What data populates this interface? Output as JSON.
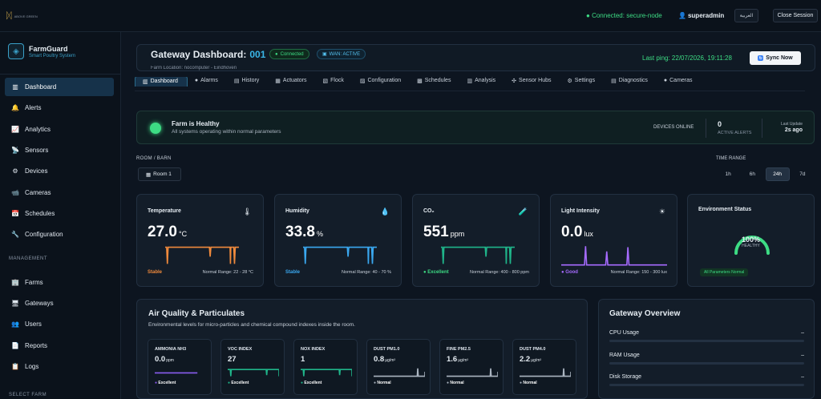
{
  "topbar": {
    "logo_text": "ABOVE\nGREEN",
    "connection": "Connected: secure-node",
    "user": "superadmin",
    "language": "العربية",
    "close_session": "Close Session"
  },
  "brand": {
    "name": "FarmGuard",
    "subtitle": "Smart Poultry System"
  },
  "sidebar": {
    "items": [
      {
        "label": "Dashboard",
        "icon": "chart-icon",
        "glyph": "▥",
        "active": true
      },
      {
        "label": "Alerts",
        "icon": "bell-icon",
        "glyph": "🔔"
      },
      {
        "label": "Analytics",
        "icon": "analytics-icon",
        "glyph": "📈"
      },
      {
        "label": "Sensors",
        "icon": "sensor-icon",
        "glyph": "📡"
      },
      {
        "label": "Devices",
        "icon": "gear-icon",
        "glyph": "⚙"
      },
      {
        "label": "Cameras",
        "icon": "camera-icon",
        "glyph": "📹"
      },
      {
        "label": "Schedules",
        "icon": "calendar-icon",
        "glyph": "📅"
      },
      {
        "label": "Configuration",
        "icon": "wrench-icon",
        "glyph": "🔧"
      }
    ],
    "management_label": "MANAGEMENT",
    "management_items": [
      {
        "label": "Farms",
        "icon": "farm-icon",
        "glyph": "🏢"
      },
      {
        "label": "Gateways",
        "icon": "gateway-icon",
        "glyph": "🖥"
      },
      {
        "label": "Users",
        "icon": "users-icon",
        "glyph": "👥"
      },
      {
        "label": "Reports",
        "icon": "report-icon",
        "glyph": "📄"
      },
      {
        "label": "Logs",
        "icon": "logs-icon",
        "glyph": "📋"
      }
    ],
    "select_farm_label": "SELECT FARM"
  },
  "gateway": {
    "title": "Gateway Dashboard:",
    "id": "001",
    "status_pill": "Connected",
    "wan_pill": "WAN: ACTIVE",
    "location": "Farm Location: nocomputer - Eindhoven",
    "last_ping": "Last ping: 22/07/2026, 19:11:28",
    "sync_label": "Sync Now"
  },
  "tabs": [
    {
      "label": "Dashboard",
      "glyph": "▥",
      "icon": "chart-icon",
      "active": true
    },
    {
      "label": "Alarms",
      "glyph": "●",
      "icon": "alarm-icon"
    },
    {
      "label": "History",
      "glyph": "▤",
      "icon": "history-icon"
    },
    {
      "label": "Actuators",
      "glyph": "▦",
      "icon": "actuator-icon"
    },
    {
      "label": "Flock",
      "glyph": "▧",
      "icon": "flock-icon"
    },
    {
      "label": "Configuration",
      "glyph": "▨",
      "icon": "config-icon"
    },
    {
      "label": "Schedules",
      "glyph": "▩",
      "icon": "schedule-icon"
    },
    {
      "label": "Analysis",
      "glyph": "▥",
      "icon": "analysis-icon"
    },
    {
      "label": "Sensor Hubs",
      "glyph": "✣",
      "icon": "hub-icon"
    },
    {
      "label": "Settings",
      "glyph": "⚙",
      "icon": "settings-icon"
    },
    {
      "label": "Diagnostics",
      "glyph": "▤",
      "icon": "diagnostics-icon"
    },
    {
      "label": "Cameras",
      "glyph": "●",
      "icon": "camera-icon"
    }
  ],
  "health": {
    "title": "Farm is Healthy",
    "subtitle": "All systems operating within normal parameters",
    "devices_label": "DEVICES ONLINE",
    "alerts_value": "0",
    "alerts_label": "ACTIVE ALERTS",
    "update_label": "Last Update",
    "update_value": "2s ago"
  },
  "room": {
    "label": "ROOM / BARN",
    "value": "Room 1"
  },
  "time_range": {
    "label": "TIME RANGE",
    "options": [
      "1h",
      "6h",
      "24h",
      "7d"
    ],
    "selected": "24h"
  },
  "cards": [
    {
      "title": "Temperature",
      "icon": "thermometer-icon",
      "glyph": "🌡",
      "value": "27.0",
      "unit": "°C",
      "status": "Stable",
      "status_color": "#f08a3c",
      "range": "Normal Range: 22 - 28 °C",
      "color": "#f08a3c",
      "spark": [
        0.3,
        0.3,
        0.3,
        0.3,
        0.3,
        0.3,
        0.3,
        0.3,
        0.3,
        0.3,
        0.3,
        0.3,
        0.3,
        0.3,
        0.3,
        0.3,
        0.3,
        0.3,
        0.3,
        0.3,
        0.3,
        0.3,
        0.3,
        0.3,
        0.3,
        0.3,
        0.3,
        0.3,
        0.3,
        0.3,
        0.3,
        0.3,
        0.3,
        0.3,
        0.3,
        0.3,
        0.3,
        0.3,
        0.3,
        0.3,
        0.3,
        0.3,
        0.3,
        0.3,
        0.3,
        0.3,
        0.3,
        0.3,
        0.3,
        0.3
      ]
    },
    {
      "title": "Humidity",
      "icon": "droplet-icon",
      "glyph": "💧",
      "value": "33.8",
      "unit": "%",
      "status": "Stable",
      "status_color": "#3aa8f0",
      "range": "Normal Range: 40 - 70 %",
      "color": "#3aa8f0"
    },
    {
      "title": "CO₂",
      "icon": "co2-icon",
      "glyph": "🧪",
      "value": "551",
      "unit": "ppm",
      "status": "Excellent",
      "status_color": "#3ddc84",
      "range": "Normal Range: 400 - 800 ppm",
      "color": "#1fb58a"
    },
    {
      "title": "Light Intensity",
      "icon": "sun-icon",
      "glyph": "☀",
      "value": "0.0",
      "unit": "lux",
      "status": "Good",
      "status_color": "#a66bff",
      "range": "Normal Range: 150 - 300 lux",
      "color": "#a66bff"
    }
  ],
  "environment": {
    "title": "Environment Status",
    "percent": "100%",
    "label": "HEALTHY",
    "badge": "All Parameters Normal",
    "level": 1.0
  },
  "air_quality": {
    "title": "Air Quality & Particulates",
    "subtitle": "Environmental levels for micro-particles and chemical compound indexes inside the room.",
    "items": [
      {
        "title": "AMMONIA NH3",
        "value": "0.0",
        "unit": "ppm",
        "status": "Excellent",
        "color": "#8a5cf0"
      },
      {
        "title": "VOC INDEX",
        "value": "27",
        "unit": "",
        "status": "Excellent",
        "color": "#1fb58a"
      },
      {
        "title": "NOX INDEX",
        "value": "1",
        "unit": "",
        "status": "Excellent",
        "color": "#1fb58a"
      },
      {
        "title": "DUST PM1.0",
        "value": "0.8",
        "unit": "µg/m³",
        "status": "Normal",
        "color": "#aab4c0"
      },
      {
        "title": "FINE PM2.5",
        "value": "1.6",
        "unit": "µg/m³",
        "status": "Normal",
        "color": "#aab4c0"
      },
      {
        "title": "DUST PM4.0",
        "value": "2.2",
        "unit": "µg/m³",
        "status": "Normal",
        "color": "#aab4c0"
      }
    ]
  },
  "gateway_overview": {
    "title": "Gateway Overview",
    "rows": [
      {
        "label": "CPU Usage",
        "value": "–"
      },
      {
        "label": "RAM Usage",
        "value": "–"
      },
      {
        "label": "Disk Storage",
        "value": "–"
      }
    ]
  }
}
